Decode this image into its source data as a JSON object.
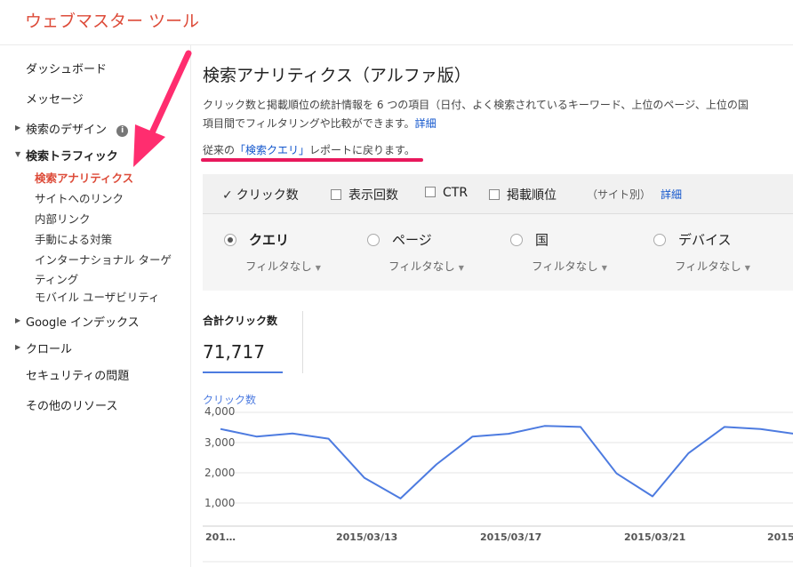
{
  "app": {
    "title": "ウェブマスター ツール"
  },
  "sidebar": {
    "items": [
      {
        "label": "ダッシュボード"
      },
      {
        "label": "メッセージ"
      },
      {
        "label": "検索のデザイン"
      },
      {
        "label": "検索トラフィック"
      },
      {
        "label": "検索アナリティクス"
      },
      {
        "label": "サイトへのリンク"
      },
      {
        "label": "内部リンク"
      },
      {
        "label": "手動による対策"
      },
      {
        "label": "インターナショナル ターゲ"
      },
      {
        "label": "ティング"
      },
      {
        "label": "モバイル ユーザビリティ"
      },
      {
        "label": "Google インデックス"
      },
      {
        "label": "クロール"
      },
      {
        "label": "セキュリティの問題"
      },
      {
        "label": "その他のリソース"
      }
    ],
    "info_icon_text": "i",
    "accent_color": "#dd4b39",
    "annotation_color": "#ff2d6f"
  },
  "main": {
    "title": "検索アナリティクス（アルファ版）",
    "description_line1": "クリック数と掲載順位の統計情報を 6 つの項目（日付、よく検索されているキーワード、上位のページ、上位の国",
    "description_line2": "項目間でフィルタリングや比較ができます。",
    "details_link": "詳細",
    "revert_prefix": "従来の",
    "revert_link": "「検索クエリ」",
    "revert_suffix": "レポートに戻ります。",
    "metrics": [
      {
        "label": "クリック数",
        "checked": true
      },
      {
        "label": "表示回数",
        "checked": false
      },
      {
        "label": "CTR",
        "checked": false
      },
      {
        "label": "掲載順位",
        "checked": false
      }
    ],
    "by_site_note": "（サイト別）",
    "metrics_details_link": "詳細",
    "groups": [
      {
        "label": "クエリ",
        "filter": "フィルタなし",
        "selected": true
      },
      {
        "label": "ページ",
        "filter": "フィルタなし",
        "selected": false
      },
      {
        "label": "国",
        "filter": "フィルタなし",
        "selected": false
      },
      {
        "label": "デバイス",
        "filter": "フィルタなし",
        "selected": false
      }
    ],
    "totals": {
      "label": "合計クリック数",
      "value": "71,717"
    }
  },
  "chart_data": {
    "type": "line",
    "series": [
      {
        "name": "クリック数",
        "color": "#4d7be0",
        "values": [
          3450,
          3200,
          3300,
          3130,
          1830,
          1150,
          2280,
          3200,
          3290,
          3550,
          3520,
          1980,
          1220,
          2650,
          3520,
          3450,
          3280
        ]
      }
    ],
    "x_tick_labels": [
      "201…",
      "2015/03/13",
      "2015/03/17",
      "2015/03/21",
      "2015"
    ],
    "y_ticks": [
      "4,000",
      "3,000",
      "2,000",
      "1,000"
    ],
    "ylim": [
      0,
      4000
    ],
    "grid": true
  }
}
